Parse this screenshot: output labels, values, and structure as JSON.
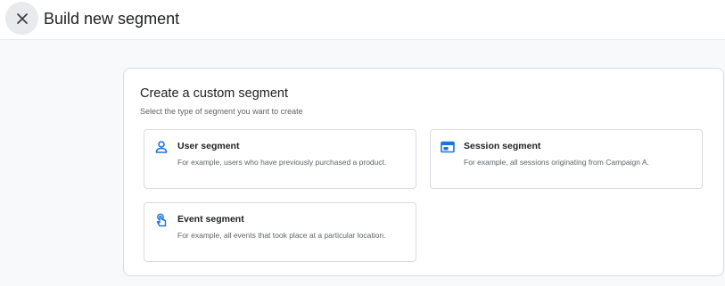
{
  "header": {
    "title": "Build new segment",
    "close_icon": "close-icon"
  },
  "panel": {
    "title": "Create a custom segment",
    "subtitle": "Select the type of segment you want to create",
    "cards": [
      {
        "icon": "person-icon",
        "title": "User segment",
        "description": "For example, users who have previously purchased a product."
      },
      {
        "icon": "session-window-icon",
        "title": "Session segment",
        "description": "For example, all sessions originating from Campaign A."
      },
      {
        "icon": "tap-hand-icon",
        "title": "Event segment",
        "description": "For example, all events that took place at a particular location."
      }
    ]
  },
  "colors": {
    "accent": "#1a73e8",
    "text_primary": "#202124",
    "text_secondary": "#5f6368",
    "border": "#dadce0",
    "page_background": "#f8f9fa"
  }
}
